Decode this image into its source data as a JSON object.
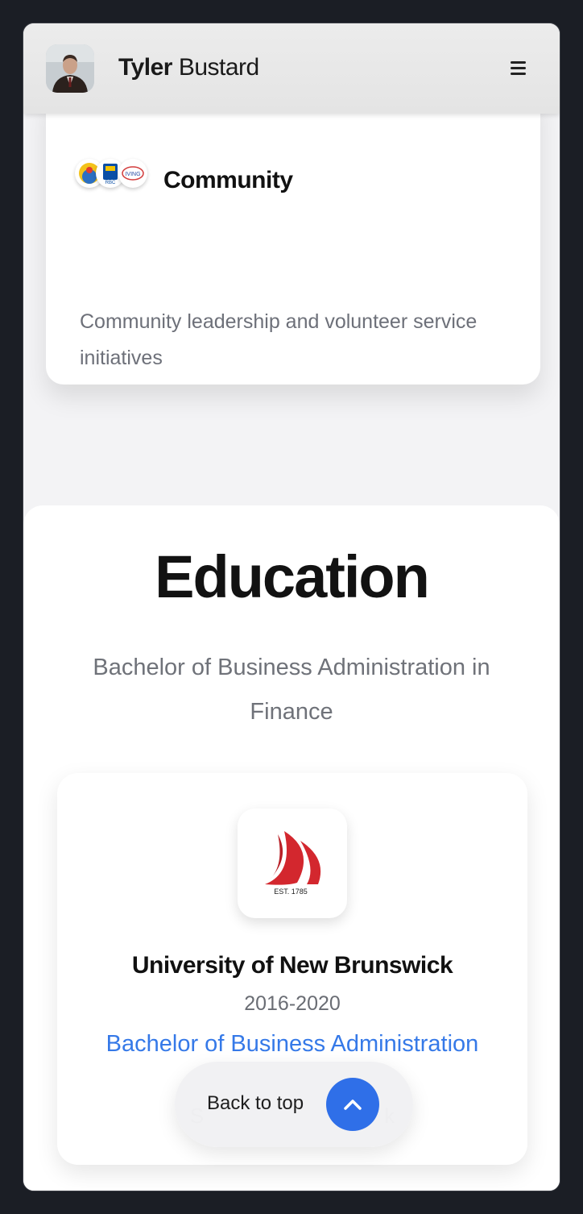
{
  "header": {
    "first_name": "Tyler",
    "last_name": "Bustard",
    "menu_icon": "hamburger-menu-icon"
  },
  "community": {
    "title": "Community",
    "description": "Community leadership and volunteer service initiatives",
    "logo_icons": [
      "circular-org-logo-icon",
      "rbc-logo-icon",
      "living-logo-icon"
    ]
  },
  "education": {
    "title": "Education",
    "subtitle": "Bachelor of Business Administration in Finance",
    "school": {
      "name": "University of New Brunswick",
      "years": "2016-2020",
      "degree": "Bachelor of Business Administration",
      "logo_text": "EST. 1785",
      "partial_line": "S                               k"
    }
  },
  "back_to_top": {
    "label": "Back to top",
    "icon": "chevron-up-icon"
  },
  "colors": {
    "accent": "#3579e8",
    "button_blue": "#2f6fe8",
    "unb_red": "#d3272e",
    "page_bg": "#1b1e25"
  }
}
